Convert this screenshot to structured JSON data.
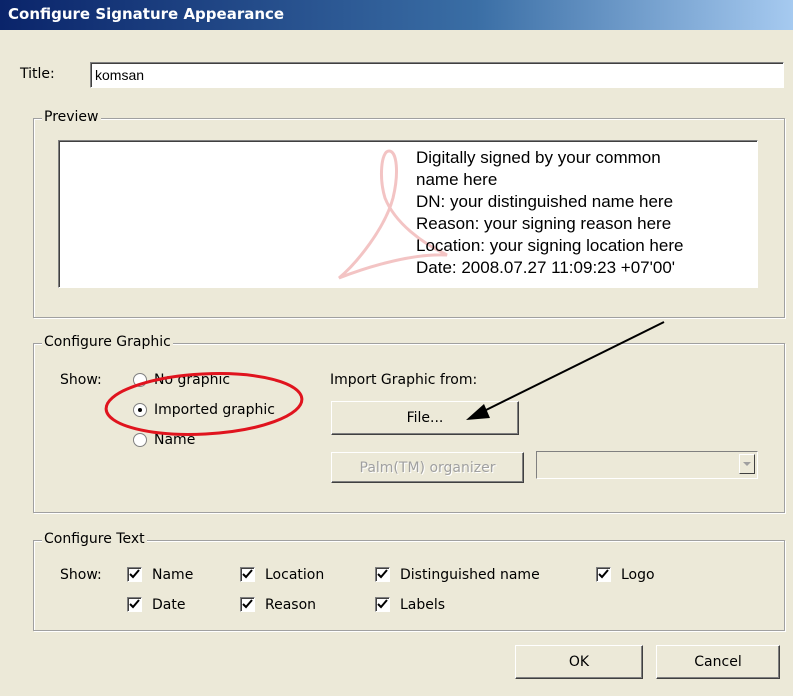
{
  "window": {
    "title": "Configure Signature Appearance"
  },
  "title_field": {
    "label": "Title:",
    "value": "komsan"
  },
  "preview": {
    "legend": "Preview",
    "lines": [
      "Digitally signed by your common",
      "name here",
      "DN: your distinguished name here",
      "Reason: your signing reason here",
      "Location: your signing location here",
      "Date: 2008.07.27 11:09:23 +07'00'"
    ]
  },
  "configure_graphic": {
    "legend": "Configure Graphic",
    "show_label": "Show:",
    "options": [
      {
        "label": "No graphic",
        "checked": false
      },
      {
        "label": "Imported graphic",
        "checked": true
      },
      {
        "label": "Name",
        "checked": false
      }
    ],
    "import_label": "Import Graphic from:",
    "file_button": "File...",
    "palm_button": "Palm(TM) organizer",
    "palm_select_value": ""
  },
  "configure_text": {
    "legend": "Configure Text",
    "show_label": "Show:",
    "checkboxes": [
      {
        "label": "Name",
        "checked": true
      },
      {
        "label": "Location",
        "checked": true
      },
      {
        "label": "Distinguished name",
        "checked": true
      },
      {
        "label": "Logo",
        "checked": true
      },
      {
        "label": "Date",
        "checked": true
      },
      {
        "label": "Reason",
        "checked": true
      },
      {
        "label": "Labels",
        "checked": true
      }
    ]
  },
  "buttons": {
    "ok": "OK",
    "cancel": "Cancel"
  },
  "colors": {
    "annotation": "#e0141e",
    "titlebar": "#0a246a",
    "dialog_bg": "#ece9d8"
  }
}
